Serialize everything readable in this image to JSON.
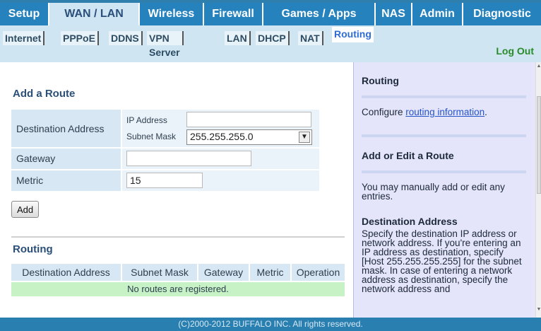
{
  "nav": {
    "tabs": [
      {
        "label": "Setup"
      },
      {
        "label": "WAN / LAN"
      },
      {
        "label": "Wireless"
      },
      {
        "label": "Firewall"
      },
      {
        "label": "Games / Apps"
      },
      {
        "label": "NAS"
      },
      {
        "label": "Admin"
      },
      {
        "label": "Diagnostic"
      }
    ],
    "active_tab": "WAN / LAN"
  },
  "subnav": {
    "items": [
      {
        "label": "Internet"
      },
      {
        "label": "PPPoE"
      },
      {
        "label": "DDNS"
      },
      {
        "label": "VPN Server"
      },
      {
        "label": "LAN"
      },
      {
        "label": "DHCP"
      },
      {
        "label": "NAT"
      },
      {
        "label": "Routing"
      }
    ],
    "active": "Routing",
    "logout": "Log Out"
  },
  "add_route": {
    "title": "Add a Route",
    "destination_label": "Destination Address",
    "ip_address_label": "IP Address",
    "ip_address_value": "",
    "subnet_mask_label": "Subnet Mask",
    "subnet_mask_value": "255.255.255.0",
    "gateway_label": "Gateway",
    "gateway_value": "",
    "metric_label": "Metric",
    "metric_value": "15",
    "add_button": "Add"
  },
  "routing_table": {
    "title": "Routing",
    "columns": [
      "Destination Address",
      "Subnet Mask",
      "Gateway",
      "Metric",
      "Operation"
    ],
    "empty_message": "No routes are registered."
  },
  "help": {
    "title1": "Routing",
    "text1_prefix": "Configure ",
    "text1_link": "routing information",
    "text1_suffix": ".",
    "title2": "Add or Edit a Route",
    "text2": "You may manually add or edit any entries.",
    "title3": "Destination Address",
    "text3": "Specify the destination IP address or network address. If you're entering an IP address as destination, specify [Host 255.255.255.255] for the subnet mask. In case of entering a network address as destination, specify the network address and"
  },
  "footer": "(C)2000-2012 BUFFALO INC. All rights reserved."
}
